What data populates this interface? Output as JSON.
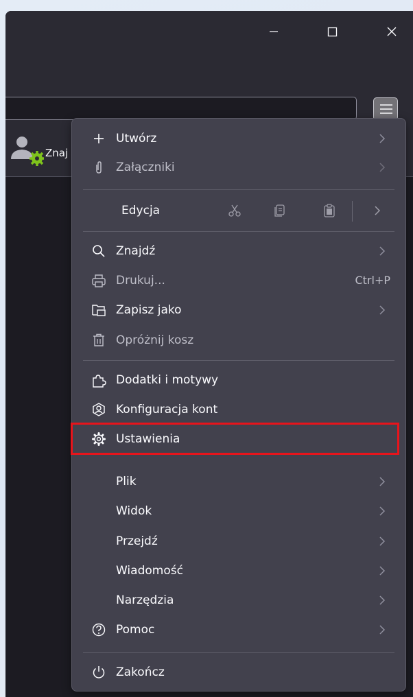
{
  "window": {
    "controls": [
      {
        "name": "minimize",
        "icon": "minimize-icon"
      },
      {
        "name": "maximize",
        "icon": "maximize-icon"
      },
      {
        "name": "close",
        "icon": "close-icon"
      }
    ]
  },
  "toolbar": {
    "menu_button_icon": "hamburger-menu-icon"
  },
  "account": {
    "icon": "account-settings-icon",
    "label": "Znaj"
  },
  "menu": {
    "create": {
      "label": "Utwórz",
      "icon": "plus-icon"
    },
    "attachments": {
      "label": "Załączniki",
      "icon": "paperclip-icon",
      "disabled": true
    },
    "edit": {
      "label": "Edycja",
      "actions": [
        "cut-icon",
        "copy-icon",
        "paste-icon"
      ]
    },
    "find": {
      "label": "Znajdź",
      "icon": "search-icon"
    },
    "print": {
      "label": "Drukuj...",
      "shortcut": "Ctrl+P",
      "icon": "printer-icon",
      "disabled": true
    },
    "save_as": {
      "label": "Zapisz jako",
      "icon": "save-as-icon"
    },
    "empty_trash": {
      "label": "Opróżnij kosz",
      "icon": "trash-icon",
      "disabled": true
    },
    "addons": {
      "label": "Dodatki i motywy",
      "icon": "puzzle-icon"
    },
    "account_setup": {
      "label": "Konfiguracja kont",
      "icon": "account-setup-icon"
    },
    "settings": {
      "label": "Ustawienia",
      "icon": "gear-icon",
      "highlighted": true
    },
    "file": {
      "label": "Plik"
    },
    "view": {
      "label": "Widok"
    },
    "go": {
      "label": "Przejdź"
    },
    "message": {
      "label": "Wiadomość"
    },
    "tools": {
      "label": "Narzędzia"
    },
    "help": {
      "label": "Pomoc",
      "icon": "help-icon"
    },
    "quit": {
      "label": "Zakończ",
      "icon": "power-icon"
    }
  },
  "colors": {
    "menu_bg": "#42414d",
    "window_bg": "#1c1b22",
    "toolbar_bg": "#2b2a33",
    "highlight_border": "#e8141b",
    "account_gear": "#7fc31c"
  }
}
